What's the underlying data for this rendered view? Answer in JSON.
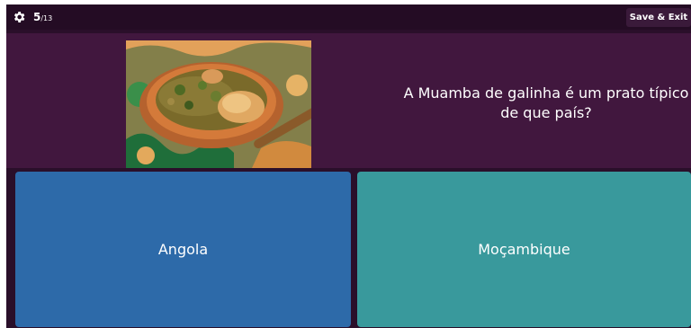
{
  "header": {
    "progress_current": "5",
    "progress_total": "/13",
    "save_exit_label": "Save & Exit",
    "settings_icon": "gear-icon"
  },
  "question": {
    "text": "A Muamba de galinha é um prato típico de que país?",
    "image_icon": "food-photo"
  },
  "answers": [
    {
      "label": "Angola",
      "color": "#2d6aa9"
    },
    {
      "label": "Moçambique",
      "color": "#39999c"
    }
  ],
  "colors": {
    "background": "#2a0f2a",
    "panel": "#41173e"
  }
}
